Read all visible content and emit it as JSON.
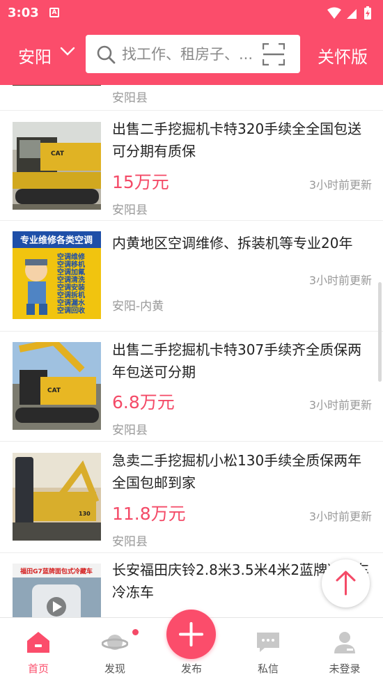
{
  "status_bar": {
    "time": "3:03",
    "notification_letter": "A"
  },
  "header": {
    "city": "安阳",
    "search_placeholder": "找工作、租房子、...",
    "care_mode_label": "关怀版",
    "accent_color": "#fb4d6b"
  },
  "listings": [
    {
      "title": "",
      "price": "",
      "time": "",
      "location": "安阳县"
    },
    {
      "title": "出售二手挖掘机卡特320手续全全国包送可分期有质保",
      "price": "15万元",
      "time": "3小时前更新",
      "location": "安阳县",
      "thumb_text": ""
    },
    {
      "title": "内黄地区空调维修、拆装机等专业20年",
      "price": "",
      "time": "3小时前更新",
      "location": "安阳-内黄",
      "thumb_text": "专业维修各类空调",
      "thumb_items": [
        "空调维修",
        "空调移机",
        "空调加氟",
        "空调清洗",
        "空调安装",
        "空调拆机",
        "空调漏水",
        "空调回收"
      ]
    },
    {
      "title": "出售二手挖掘机卡特307手续齐全质保两年包送可分期",
      "price": "6.8万元",
      "time": "3小时前更新",
      "location": "安阳县"
    },
    {
      "title": "急卖二手挖掘机小松130手续全质保两年全国包邮到家",
      "price": "11.8万元",
      "time": "3小时前更新",
      "location": "安阳县"
    },
    {
      "title": "长安福田庆铃2.8米3.5米4米2蓝牌冷藏车冷冻车",
      "price": "",
      "time": "",
      "location": "",
      "thumb_text": "福田G7蓝牌面包式冷藏车"
    }
  ],
  "tabs": [
    {
      "label": "首页",
      "icon": "home-icon",
      "active": true
    },
    {
      "label": "发现",
      "icon": "planet-icon",
      "active": false
    },
    {
      "label": "发布",
      "icon": "plus-icon",
      "active": false
    },
    {
      "label": "私信",
      "icon": "message-icon",
      "active": false
    },
    {
      "label": "未登录",
      "icon": "user-icon",
      "active": false
    }
  ]
}
